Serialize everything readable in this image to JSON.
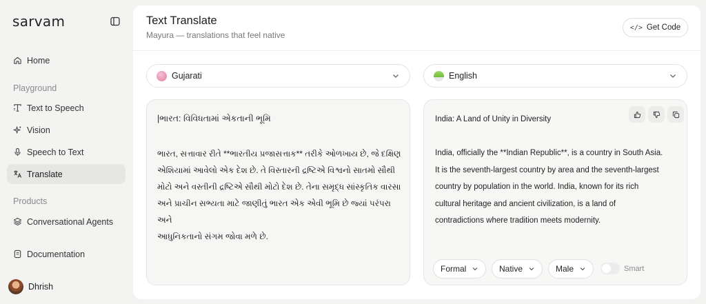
{
  "sidebar": {
    "brand": "sarvam",
    "nav_home": "Home",
    "section_playground": "Playground",
    "playground_items": [
      "Text to Speech",
      "Vision",
      "Speech to Text",
      "Translate"
    ],
    "section_products": "Products",
    "products_items": [
      "Conversational Agents"
    ],
    "documentation": "Documentation",
    "user_name": "Dhrish"
  },
  "header": {
    "title": "Text Translate",
    "subtitle": "Mayura — translations that feel native",
    "get_code_label": "Get Code"
  },
  "source": {
    "language": "Gujarati",
    "title": "|ભારત: વિવિધતામાં એકતાની ભૂમિ",
    "lines": [
      "ભારત, સત્તાવાર રીતે **ભારતીય પ્રજાસત્તાક** તરીકે ઓળખાય છે, જે દક્ષિણ",
      "એશિયામાં આવેલો એક દેશ છે. તે વિસ્તારની દ્રષ્ટિએ વિશ્વનો સાતમો સૌથી",
      "મોટો અને વસ્તીની દ્રષ્ટિએ સૌથી મોટો દેશ છે. તેના સમૃદ્ધ સાંસ્કૃતિક વારસા",
      "અને પ્રાચીન સભ્યતા માટે જાણીતું ભારત એક એવી ભૂમિ છે જ્યાં પરંપરા અને",
      "આધુનિકતાનો સંગમ જોવા મળે છે."
    ]
  },
  "target": {
    "language": "English",
    "title": "India: A Land of Unity in Diversity",
    "lines": [
      "India, officially the **Indian Republic**, is a country in South Asia.",
      "It is the seventh-largest country by area and the seventh-largest",
      "country by population in the world. India, known for its rich",
      "cultural heritage and ancient civilization, is a land of",
      "contradictions where tradition meets modernity."
    ],
    "options": {
      "tone": "Formal",
      "style": "Native",
      "gender": "Male",
      "smart_label": "Smart",
      "smart_enabled": false
    }
  },
  "colors": {
    "gujarati_dot": "#e07aa0",
    "english_dot": "#6fbf3a",
    "active_nav_bg": "#e6e6e4"
  }
}
